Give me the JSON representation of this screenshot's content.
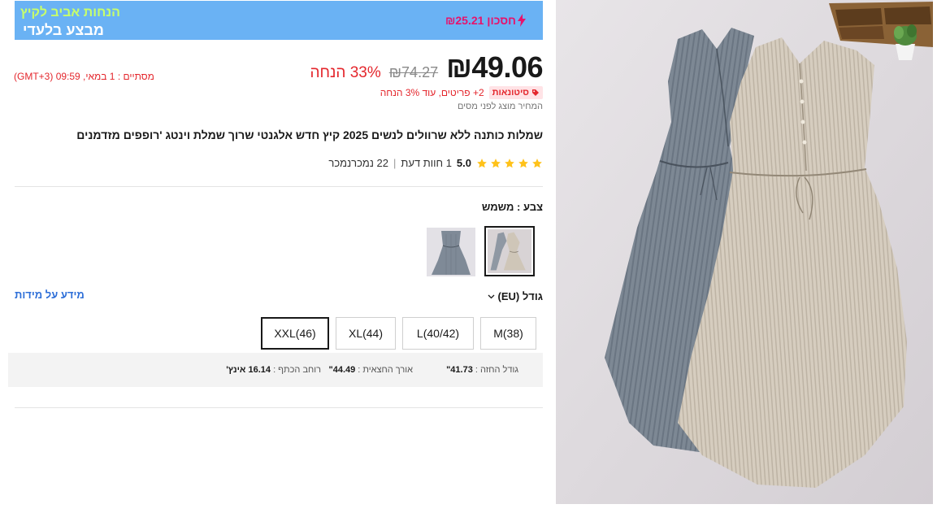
{
  "promo": {
    "title": "הנחות אביב לקיץ",
    "subtitle": "מבצע בלעדי",
    "savings": "חסכון ₪25.21"
  },
  "countdown": "מסתיים : 1 במאי, 09:59 (GMT+3)",
  "price": {
    "current": "₪49.06",
    "original": "₪74.27",
    "discount": "33% הנחה"
  },
  "bulk": {
    "badge": "סיטונאות",
    "text": "2+ פריטים, עוד 3% הנחה"
  },
  "tax_note": "המחיר מוצג לפני מסים",
  "product_title": "שמלות כותנה ללא שרוולים לנשים 2025 קיץ חדש אלגנטי שרוך שמלת וינטג 'רופפים מזדמנים",
  "rating": {
    "stars": 5,
    "value": "5.0",
    "reviews": "1 חוות דעת",
    "separator": "|",
    "sold": "22 נמכרנמכר"
  },
  "color": {
    "label": "צבע : משמש",
    "options": [
      "משמש",
      "אפור"
    ],
    "selected": "משמש"
  },
  "size": {
    "label": "גודל (EU)",
    "guide": "מידע על מידות",
    "options": [
      "M(38)",
      "L(40/42)",
      "XL(44)",
      "XXL(46)"
    ],
    "selected": "XXL(46)"
  },
  "measurements": {
    "bust_label": "גודל החזה : ",
    "bust_value": "41.73\"",
    "hips_label": "אורך החצאית : ",
    "hips_value": "44.49\"",
    "shoulder_label": "רוחב הכתף : ",
    "shoulder_value": "16.14 אינץ'"
  },
  "colors": {
    "accent": "#e4262c",
    "banner": "#6ab2f4",
    "link": "#2e6fd8",
    "star": "#ffc21a"
  }
}
